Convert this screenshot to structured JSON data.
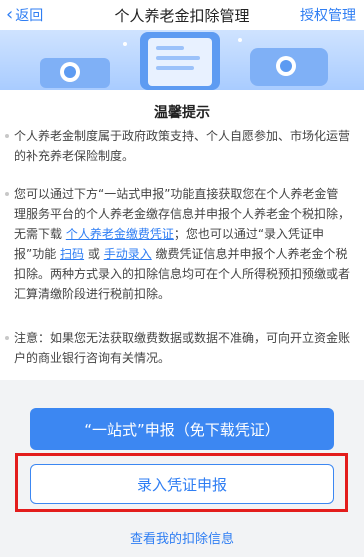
{
  "header": {
    "back_label": "返回",
    "title": "个人养老金扣除管理",
    "auth_label": "授权管理"
  },
  "notice": {
    "title": "温馨提示",
    "para1": "个人养老金制度属于政府政策支持、个人自愿参加、市场化运营的补充养老保险制度。",
    "para2_a": "您可以通过下方“一站式申报”功能直接获取您在个人养老金管理服务平台的个人养老金缴存信息并申报个人养老金个税扣除，无需下载 ",
    "para2_link1": "个人养老金缴费凭证",
    "para2_b": "；您也可以通过“录入凭证申报”功能 ",
    "para2_link2": "扫码",
    "para2_c": " 或 ",
    "para2_link3": "手动录入",
    "para2_d": " 缴费凭证信息并申报个人养老金个税扣除。两种方式录入的扣除信息均可在个人所得税预扣预缴或者汇算清缴阶段进行税前扣除。",
    "para3": "注意：如果您无法获取缴费数据或数据不准确，可向开立资金账户的商业银行咨询有关情况。"
  },
  "actions": {
    "one_stop_label": "“一站式”申报（免下载凭证）",
    "voucher_label": "录入凭证申报",
    "view_label": "查看我的扣除信息"
  },
  "colors": {
    "accent": "#3c87f2",
    "highlight": "#e31c1c"
  }
}
